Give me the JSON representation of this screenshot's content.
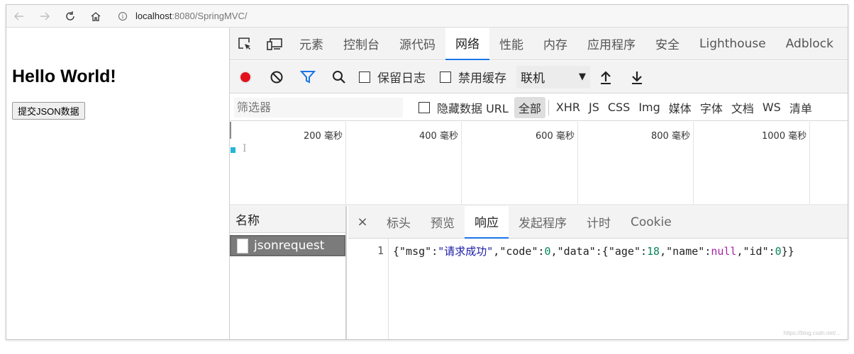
{
  "browser": {
    "url_host": "localhost",
    "url_path": ":8080/SpringMVC/",
    "info_glyph": "i"
  },
  "page": {
    "heading": "Hello World!",
    "submit_label": "提交JSON数据"
  },
  "devtools": {
    "tabs": [
      "元素",
      "控制台",
      "源代码",
      "网络",
      "性能",
      "内存",
      "应用程序",
      "安全",
      "Lighthouse",
      "Adblock"
    ],
    "active_tab": "网络",
    "toolbar": {
      "preserve_log": "保留日志",
      "disable_cache": "禁用缓存",
      "throttle": "联机",
      "throttle_arrow": "▼"
    },
    "filter": {
      "placeholder": "筛选器",
      "hide_data_urls": "隐藏数据 URL",
      "types": [
        "全部",
        "XHR",
        "JS",
        "CSS",
        "Img",
        "媒体",
        "字体",
        "文档",
        "WS",
        "清单"
      ],
      "selected_type": "全部"
    },
    "overview": {
      "ticks": [
        "200 毫秒",
        "400 毫秒",
        "600 毫秒",
        "800 毫秒",
        "1000 毫秒"
      ],
      "cursor_glyph": "I"
    },
    "requests": {
      "name_header": "名称",
      "items": [
        "jsonrequest"
      ]
    },
    "detail": {
      "close_glyph": "×",
      "tabs": [
        "标头",
        "预览",
        "响应",
        "发起程序",
        "计时",
        "Cookie"
      ],
      "active_tab": "响应",
      "line_number": "1",
      "response": {
        "t0": "{",
        "k1": "\"msg\"",
        "c1": ":",
        "v1": "\"请求成功\"",
        "s1": ",",
        "k2": "\"code\"",
        "c2": ":",
        "v2": "0",
        "s2": ",",
        "k3": "\"data\"",
        "c3": ":{",
        "k4": "\"age\"",
        "c4": ":",
        "v4": "18",
        "s4": ",",
        "k5": "\"name\"",
        "c5": ":",
        "v5": "null",
        "s5": ",",
        "k6": "\"id\"",
        "c6": ":",
        "v6": "0",
        "t1": "}}"
      }
    }
  },
  "watermark": "https://blog.csdn.net/..."
}
